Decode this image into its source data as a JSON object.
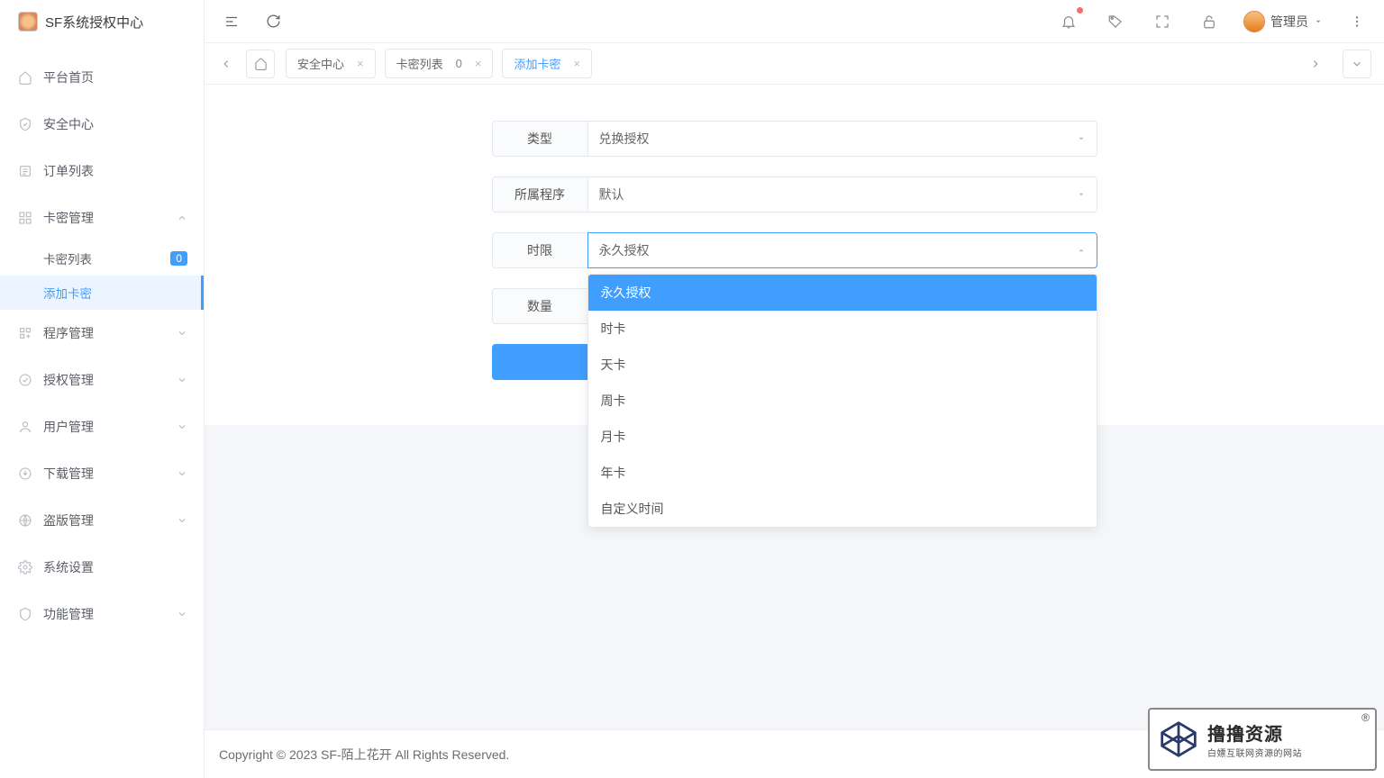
{
  "app": {
    "title": "SF系统授权中心"
  },
  "topbar": {
    "user_label": "管理员"
  },
  "sidebar": {
    "items": [
      {
        "label": "平台首页",
        "icon": "home"
      },
      {
        "label": "安全中心",
        "icon": "shield"
      },
      {
        "label": "订单列表",
        "icon": "list"
      },
      {
        "label": "卡密管理",
        "icon": "grid",
        "expandable": true,
        "expanded": true,
        "children": [
          {
            "label": "卡密列表",
            "badge": "0"
          },
          {
            "label": "添加卡密",
            "active": true
          }
        ]
      },
      {
        "label": "程序管理",
        "icon": "apps",
        "expandable": true
      },
      {
        "label": "授权管理",
        "icon": "check",
        "expandable": true
      },
      {
        "label": "用户管理",
        "icon": "user",
        "expandable": true
      },
      {
        "label": "下载管理",
        "icon": "download",
        "expandable": true
      },
      {
        "label": "盗版管理",
        "icon": "globe",
        "expandable": true
      },
      {
        "label": "系统设置",
        "icon": "gear"
      },
      {
        "label": "功能管理",
        "icon": "shield2",
        "expandable": true
      }
    ]
  },
  "tabs": {
    "items": [
      {
        "label": "安全中心"
      },
      {
        "label": "卡密列表",
        "badge": "0"
      },
      {
        "label": "添加卡密",
        "active": true
      }
    ]
  },
  "form": {
    "type": {
      "label": "类型",
      "value": "兑换授权"
    },
    "program": {
      "label": "所属程序",
      "value": "默认"
    },
    "duration": {
      "label": "时限",
      "value": "永久授权",
      "options": [
        "永久授权",
        "时卡",
        "天卡",
        "周卡",
        "月卡",
        "年卡",
        "自定义时间"
      ]
    },
    "quantity": {
      "label": "数量"
    }
  },
  "footer": {
    "text": "Copyright © 2023 SF-陌上花开 All Rights Reserved."
  },
  "watermark": {
    "main": "撸撸资源",
    "sub": "白嫖互联网资源的网站",
    "reg": "®"
  }
}
